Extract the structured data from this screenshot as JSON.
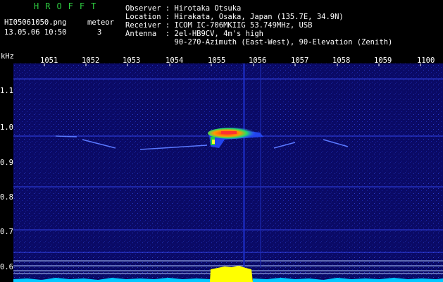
{
  "header": {
    "brand": "HROFFT",
    "filename": "HI05061050.png",
    "datetime": "13.05.06 10:50",
    "meteor_label": "meteor",
    "meteor_count": "3"
  },
  "observer": {
    "rows": [
      "Observer : Hirotaka Otsuka",
      "Location : Hirakata, Osaka, Japan (135.7E, 34.9N)",
      "Receiver : ICOM IC-706MKIIG 53.749MHz, USB",
      "Antenna  : 2el-HB9CV, 4m's high",
      "           90-270-Azimuth (East-West), 90-Elevation (Zenith)"
    ]
  },
  "axes": {
    "y_unit": "kHz",
    "x_ticks": [
      "1051",
      "1052",
      "1053",
      "1054",
      "1055",
      "1056",
      "1057",
      "1058",
      "1059",
      "1100"
    ],
    "y_ticks": [
      "1.1",
      "1.0",
      "0.9",
      "0.8",
      "0.7",
      "0.6"
    ]
  },
  "colors": {
    "background": "#0b0b6e",
    "brand": "#2ecc40",
    "signal_hot": "#ff2020",
    "signal_warm": "#ffff00",
    "baseline": "#00c8ff",
    "audio_burst": "#ffff00"
  }
}
